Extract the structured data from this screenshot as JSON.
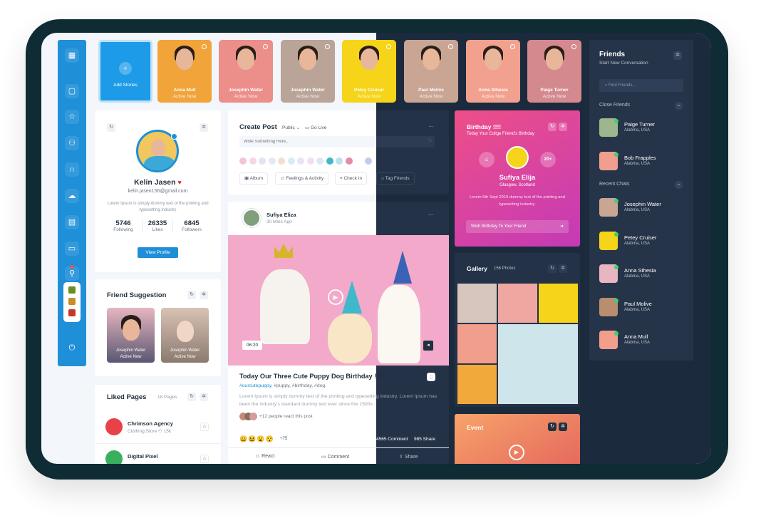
{
  "stories": [
    {
      "name": "Add Stories",
      "status": "",
      "color": "#1d9be8"
    },
    {
      "name": "Anna Mull",
      "status": "Active Now",
      "color": "#f0a43a"
    },
    {
      "name": "Josephin Water",
      "status": "Active Now",
      "color": "#ec8e8a"
    },
    {
      "name": "Josephin Water",
      "status": "Active Now",
      "color": "#b9a497"
    },
    {
      "name": "Petey Cruiser",
      "status": "Active Now",
      "color": "#f5d41a"
    },
    {
      "name": "Paul Molive",
      "status": "Active Now",
      "color": "#c9a594"
    },
    {
      "name": "Anna Sthesia",
      "status": "Active Now",
      "color": "#f2a18f"
    },
    {
      "name": "Paige Turner",
      "status": "Active Now",
      "color": "#d4898e"
    }
  ],
  "profile": {
    "name": "Kelin Jasen",
    "email": "kelin.jasen156@gmail.com",
    "bio": "Lorem Ipsum is simply dummy text of the printing and typesetting industry",
    "stats": [
      {
        "value": "5746",
        "label": "Following"
      },
      {
        "value": "26335",
        "label": "Likes"
      },
      {
        "value": "6845",
        "label": "Followers"
      }
    ],
    "button": "View Profile"
  },
  "suggestion": {
    "title": "Friend Suggestion",
    "people": [
      {
        "name": "Josephin Water",
        "status": "Active Now"
      },
      {
        "name": "Josephin Water",
        "status": "Active Now"
      }
    ]
  },
  "liked": {
    "title": "Liked Pages",
    "count": "18 Pages",
    "pages": [
      {
        "name": "Chrimson Agency",
        "category": "Clothing Store",
        "likes": "15k",
        "color": "#e8414a"
      },
      {
        "name": "Digital Pixel",
        "category": "",
        "likes": "",
        "color": "#3ab05f"
      }
    ]
  },
  "create": {
    "title": "Create Post",
    "privacy": "Public",
    "live": "Go Live",
    "placeholder": "Write Something Here..",
    "actions": [
      "Album",
      "Feelings & Activity",
      "Check In",
      "Tag Friends"
    ]
  },
  "post": {
    "author": "Sufiya Eliza",
    "time": "30 Mins Ago",
    "duration": "06:20",
    "heading": "Today Our Three Cute Puppy Dog Birthday !!!!",
    "tags_main": "#ourcutepuppy,",
    "tags_rest": " #puppy, #birthday, #dog",
    "text": "Lorem Ipsum is simply dummy text of the printing and typesetting industry. Lorem Ipsum has been the industry's standard dummy text ever since the 1500s",
    "reacts": "+12 people react this post",
    "count": "+75",
    "comments": "4565 Comment",
    "shares": "985 Share",
    "react": "React",
    "comment": "Comment",
    "share": "Share"
  },
  "birthday": {
    "title": "Birthday !!!!",
    "sub": "Today Your Collge Friend's Birthday",
    "badge": "20+",
    "name": "Sufiya Elija",
    "location": "Glasgow, Scotland",
    "text": "Lorem 5th Sept 2019 dummy text of the printing and typesetting industry.",
    "wish": "Wish Birthday To Your Friend"
  },
  "gallery": {
    "title": "Gallery",
    "count": "156 Photos"
  },
  "event": {
    "title": "Event"
  },
  "friends": {
    "title": "Friends",
    "sub": "Start New Conversation",
    "search": "Find Friends...",
    "close": "Close Friends",
    "recent": "Recent Chats",
    "closeList": [
      {
        "name": "Paige Turner",
        "loc": "Alabma, USA"
      },
      {
        "name": "Bob Frapples",
        "loc": "Alabma, USA"
      }
    ],
    "recentList": [
      {
        "name": "Josephin Water",
        "loc": "Alabma, USA"
      },
      {
        "name": "Petey Cruiser",
        "loc": "Alabma, USA"
      },
      {
        "name": "Anna Sthesia",
        "loc": "Alabma, USA"
      },
      {
        "name": "Paul Molive",
        "loc": "Alabma, USA"
      },
      {
        "name": "Anna Mull",
        "loc": "Alabma, USA"
      }
    ]
  }
}
